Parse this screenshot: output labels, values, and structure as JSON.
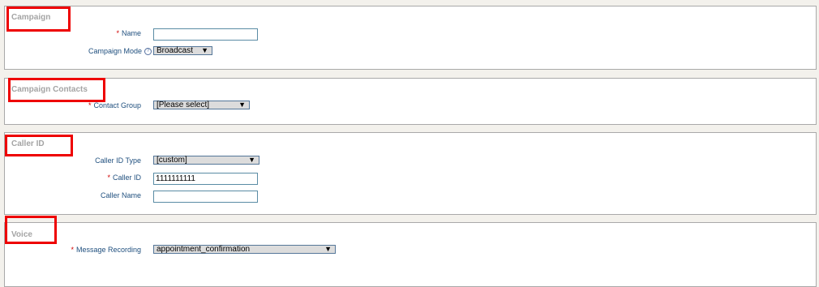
{
  "sections": {
    "campaign": {
      "title": "Campaign",
      "name_label": "Name",
      "name_value": "",
      "mode_label": "Campaign Mode",
      "mode_help": "?",
      "mode_value": "Broadcast"
    },
    "contacts": {
      "title": "Campaign Contacts",
      "group_label": "Contact Group",
      "group_value": "[Please select]"
    },
    "caller_id": {
      "title": "Caller ID",
      "type_label": "Caller ID Type",
      "type_value": "[custom]",
      "id_label": "Caller ID",
      "id_value": "1111111111",
      "name_label": "Caller Name",
      "name_value": ""
    },
    "voice": {
      "title": "Voice",
      "recording_label": "Message Recording",
      "recording_value": "appointment_confirmation"
    }
  },
  "required_marker": "*",
  "dropdown_arrow": "▼",
  "colors": {
    "highlight": "#ee0000",
    "label": "#1f4f7e",
    "required": "#d00000",
    "legend": "#a4a4a4"
  }
}
